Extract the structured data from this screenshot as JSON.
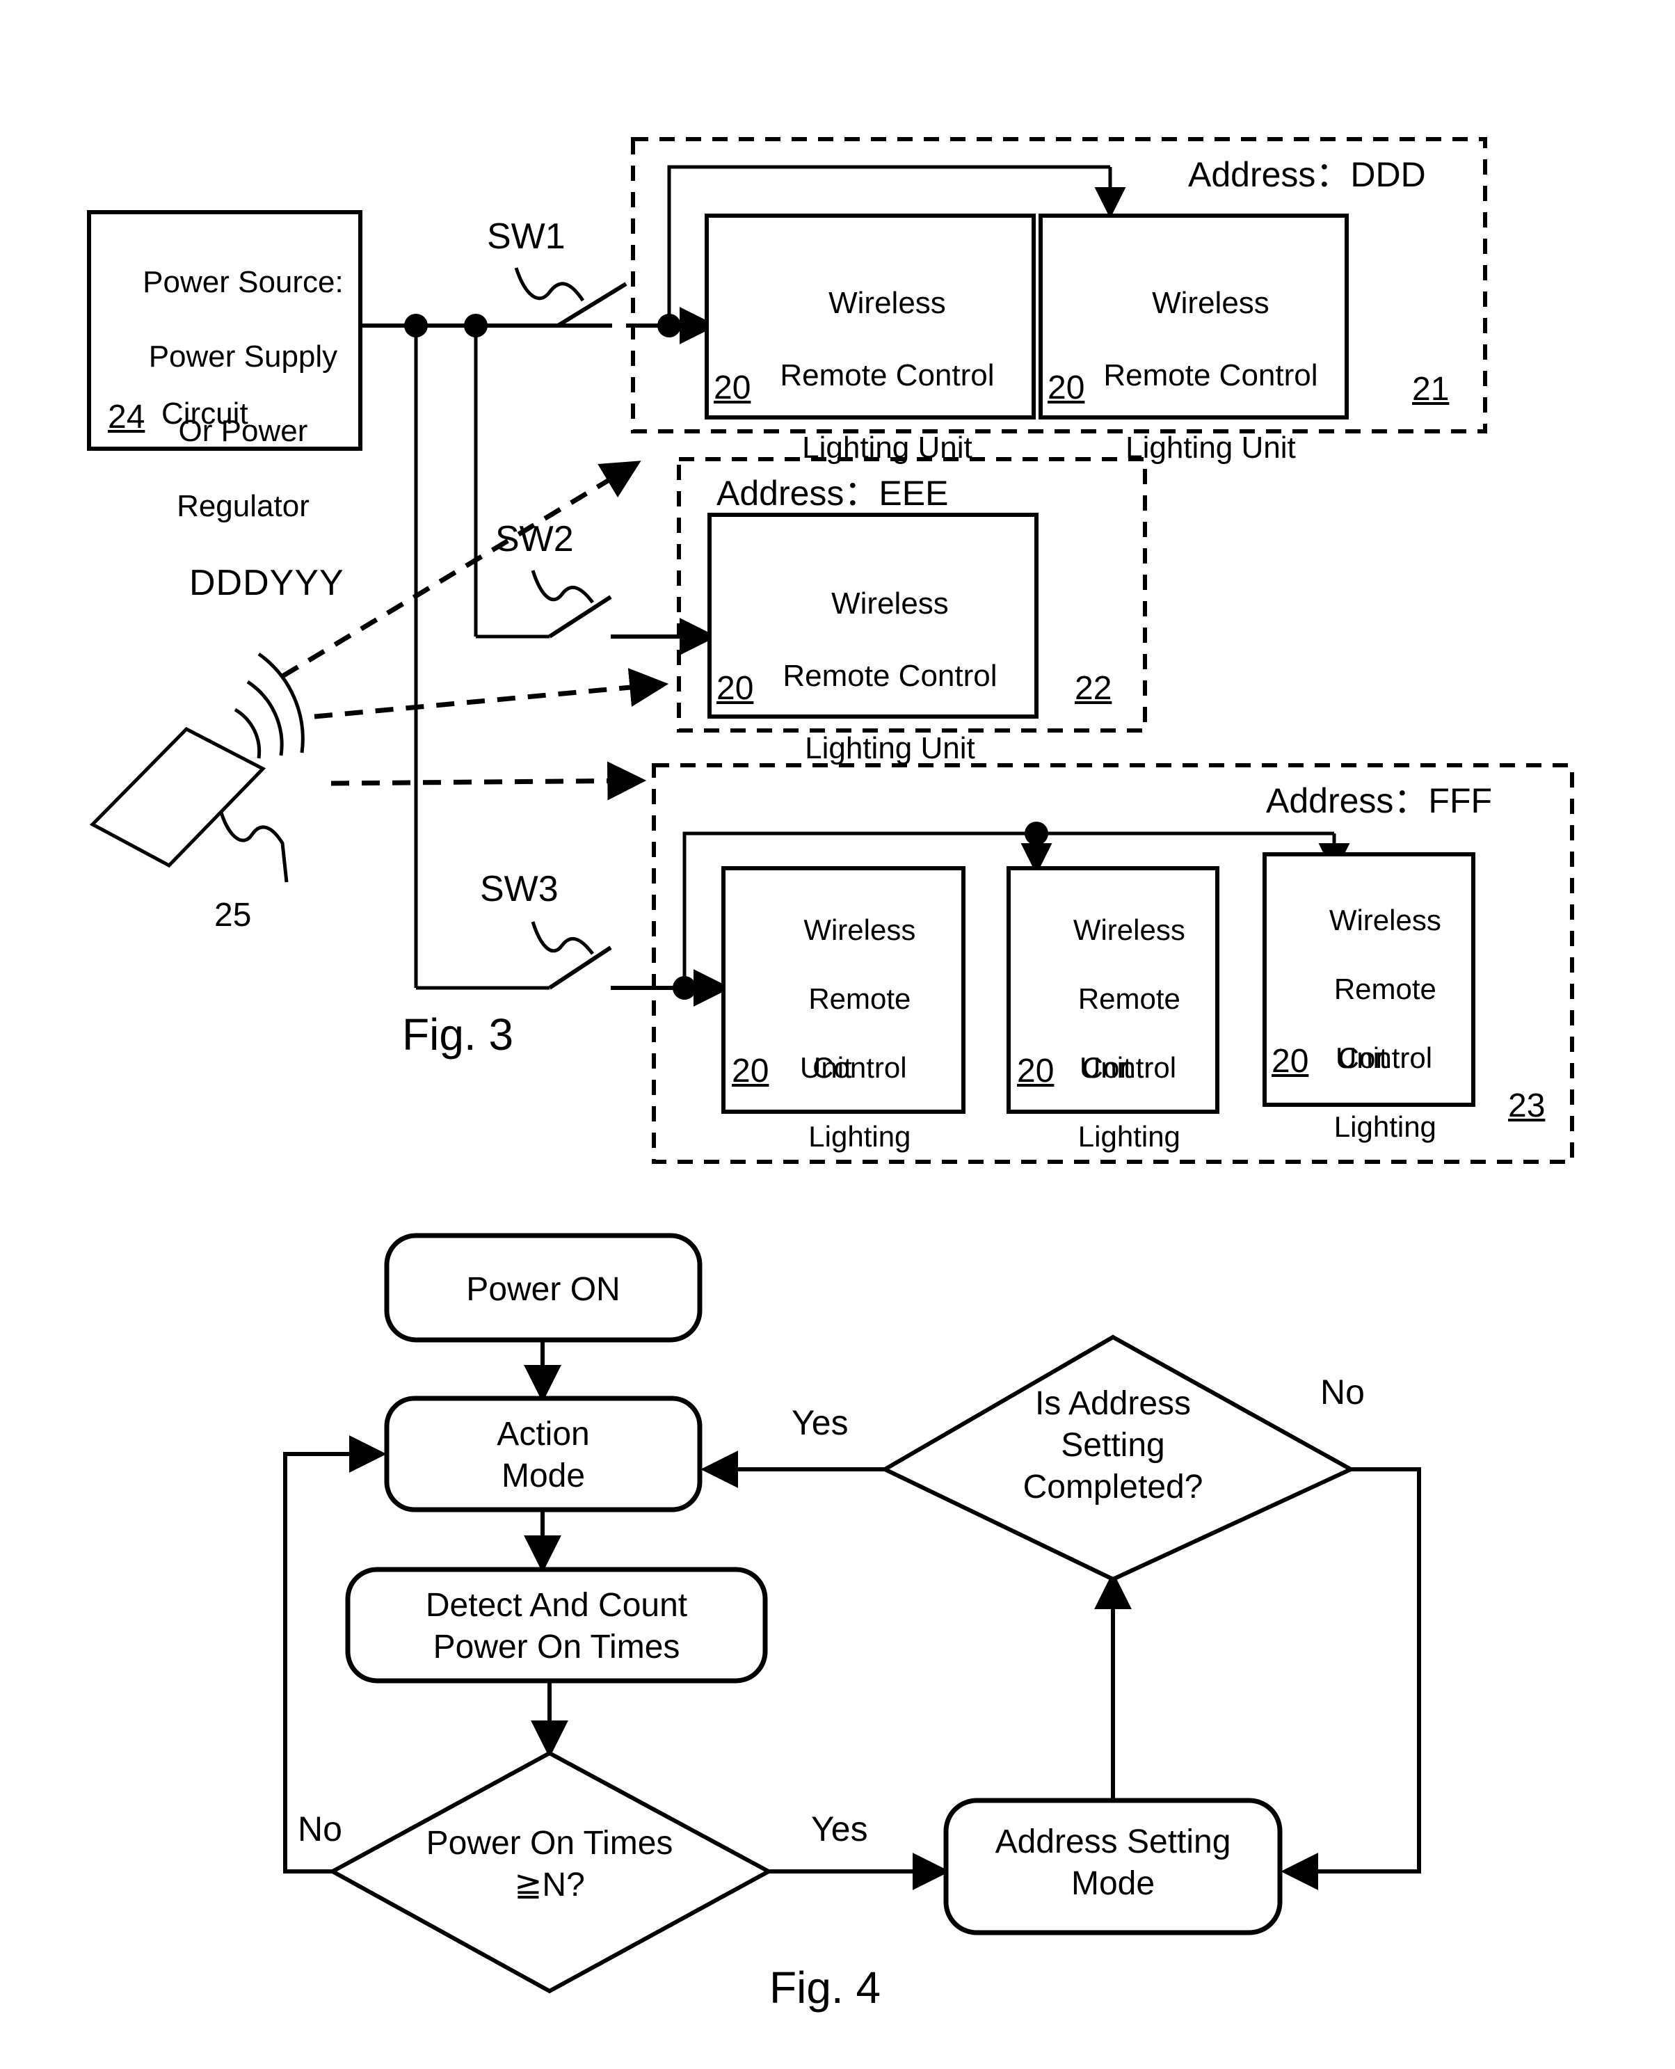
{
  "figures": {
    "fig3": {
      "caption": "Fig. 3",
      "power_source": {
        "lines": [
          "Power Source:",
          "Power Supply",
          "Or Power",
          "Regulator",
          "Circuit"
        ],
        "ref": "24"
      },
      "switches": [
        {
          "label": "SW1"
        },
        {
          "label": "SW2"
        },
        {
          "label": "SW3"
        }
      ],
      "remote": {
        "signal_code": "DDDYYY",
        "ref": "25"
      },
      "unit_ref": "20",
      "groups": [
        {
          "address_label": "Address：DDD",
          "group_ref": "21",
          "units": [
            {
              "lines": [
                "Wireless",
                "Remote Control",
                "Lighting Unit"
              ],
              "ref": "20"
            },
            {
              "lines": [
                "Wireless",
                "Remote Control",
                "Lighting Unit"
              ],
              "ref": "20"
            }
          ]
        },
        {
          "address_label": "Address：EEE",
          "group_ref": "22",
          "units": [
            {
              "lines": [
                "Wireless",
                "Remote Control",
                "Lighting Unit"
              ],
              "ref": "20"
            }
          ]
        },
        {
          "address_label": "Address：FFF",
          "group_ref": "23",
          "units": [
            {
              "lines": [
                "Wireless",
                "Remote",
                "Control",
                "Lighting",
                "Unit"
              ],
              "ref": "20"
            },
            {
              "lines": [
                "Wireless",
                "Remote",
                "Control",
                "Lighting",
                "Unit"
              ],
              "ref": "20"
            },
            {
              "lines": [
                "Wireless",
                "Remote",
                "Control",
                "Lighting",
                "Unit"
              ],
              "ref": "20"
            }
          ]
        }
      ]
    },
    "fig4": {
      "caption": "Fig. 4",
      "nodes": {
        "power_on": "Power ON",
        "action_mode": "Action\nMode",
        "detect_count": "Detect And Count\nPower On Times",
        "decision_times": "Power On Times\n≧N?",
        "address_setting_mode": "Address Setting\nMode",
        "decision_completed": "Is Address\nSetting\nCompleted?"
      },
      "edge_labels": {
        "completed_yes": "Yes",
        "completed_no": "No",
        "times_yes": "Yes",
        "times_no": "No"
      }
    }
  }
}
